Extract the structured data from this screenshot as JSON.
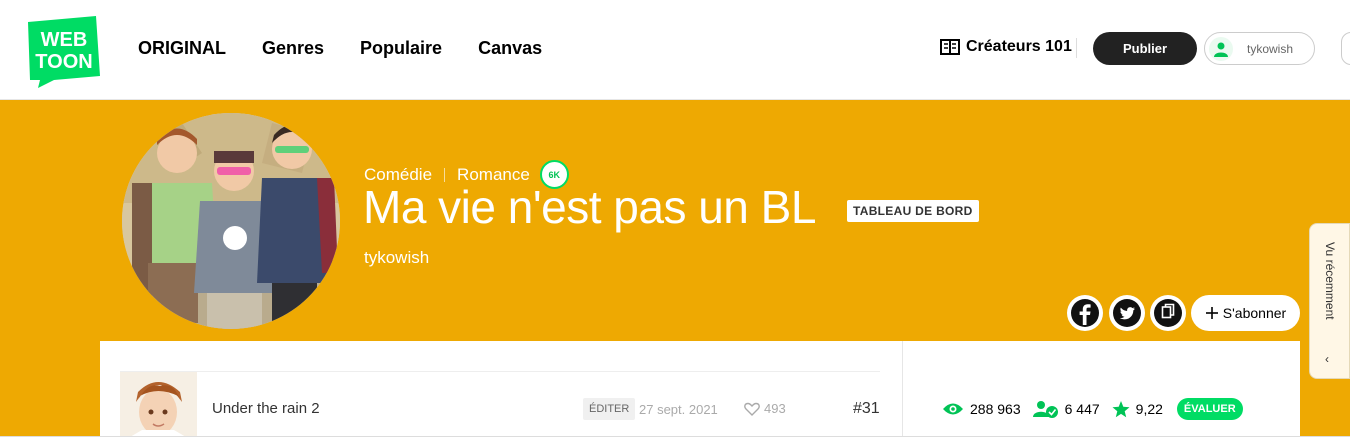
{
  "brand": {
    "line1": "WEB",
    "line2": "TOON",
    "color": "#00dc64"
  },
  "nav": [
    "ORIGINAL",
    "Genres",
    "Populaire",
    "Canvas"
  ],
  "header": {
    "creators_label": "Créateurs 101",
    "publish_label": "Publier",
    "username": "tykowish"
  },
  "series": {
    "genres": [
      "Comédie",
      "Romance"
    ],
    "badge": "6K",
    "title": "Ma vie n'est pas un BL",
    "dashboard_label": "TABLEAU DE BORD",
    "author": "tykowish",
    "banner_color": "#eea902"
  },
  "actions": {
    "subscribe_label": "S'abonner",
    "social": [
      "facebook",
      "twitter",
      "copy-link"
    ]
  },
  "side_tab": {
    "label": "Vu récemment",
    "chevron": "‹"
  },
  "episode": {
    "title": "Under the rain 2",
    "edit_label": "ÉDITER",
    "date": "27 sept. 2021",
    "likes": "493",
    "number": "#31"
  },
  "stats": {
    "views": "288 963",
    "subscribers": "6 447",
    "rating": "9,22",
    "rate_label": "ÉVALUER"
  }
}
